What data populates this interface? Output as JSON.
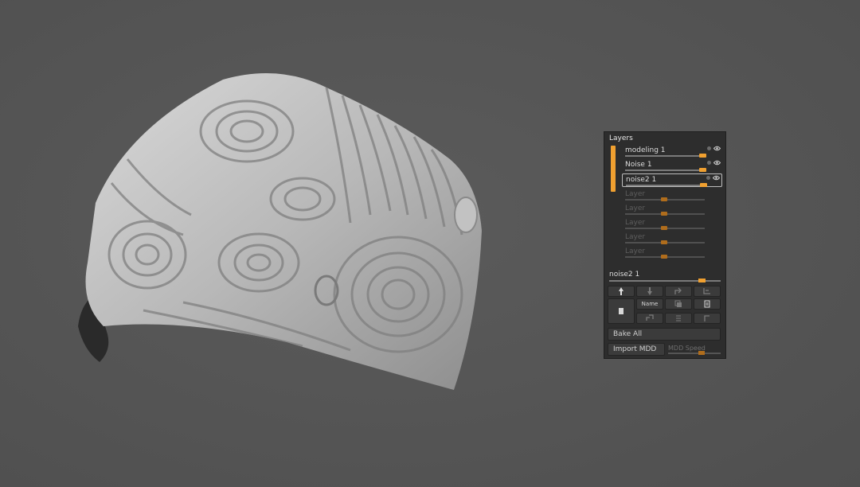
{
  "panel": {
    "title": "Layers",
    "accent_color": "#f0a030"
  },
  "layers": [
    {
      "name": "modeling 1",
      "intensity": 1.0,
      "selected": false
    },
    {
      "name": "Noise 1",
      "intensity": 1.0,
      "selected": false
    },
    {
      "name": "noise2 1",
      "intensity": 1.0,
      "selected": true
    }
  ],
  "empty_layers": [
    {
      "name": "Layer"
    },
    {
      "name": "Layer"
    },
    {
      "name": "Layer"
    },
    {
      "name": "Layer"
    },
    {
      "name": "Layer"
    }
  ],
  "active_layer": {
    "name": "noise2 1",
    "intensity": 0.8
  },
  "buttons": {
    "name_label": "Name",
    "bake_all_label": "Bake All",
    "import_mdd_label": "Import MDD",
    "mdd_speed_label": "MDD Speed"
  },
  "icons": [
    "record-icon",
    "eye-icon",
    "move-up-icon",
    "move-down-icon",
    "split-icon",
    "merge-down-icon",
    "new-layer-icon",
    "duplicate-icon",
    "delete-icon",
    "insert-icon",
    "sort-icon"
  ]
}
